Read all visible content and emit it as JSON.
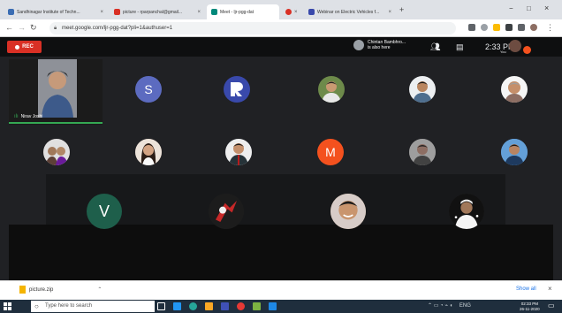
{
  "browser": {
    "tabs": [
      {
        "label": "Sandhinagar Institute of Techn...",
        "favicon_color": "#3b6db3"
      },
      {
        "label": "picture - rparpanchal@gmail...",
        "favicon_color": "#d93025"
      },
      {
        "label": "Meet - ljr-pgg-dat",
        "favicon_color": "#00897b",
        "active": true
      },
      {
        "label": "",
        "favicon_color": "#d93025"
      },
      {
        "label": "Webinar on Electric Vehicles f...",
        "favicon_color": "#3949ab"
      }
    ],
    "new_tab": "+",
    "window_controls": [
      "−",
      "□",
      "×"
    ],
    "url": "meet.google.com/ljr-pgg-dat?pli=1&authuser=1"
  },
  "meet": {
    "rec_label": "REC",
    "notice": {
      "name": "Chintan Bambhro...",
      "text": "is also here"
    },
    "time": "2:33 PM",
    "you_label": "You",
    "self_name": "Nirav Joshi",
    "participants": [
      {
        "kind": "letter",
        "letter": "S",
        "color": "#5c6bc0"
      },
      {
        "kind": "letter",
        "letter": "R",
        "color": "#3949ab"
      },
      {
        "kind": "photo",
        "color": "#6d8a4a"
      },
      {
        "kind": "photo",
        "color": "#8d6e63"
      },
      {
        "kind": "photo",
        "color": "#a1887f"
      },
      {
        "kind": "photo",
        "color": "#5d4037"
      },
      {
        "kind": "photo",
        "color": "#8d6e63"
      },
      {
        "kind": "photo",
        "color": "#5d6d7e"
      },
      {
        "kind": "letter",
        "letter": "M",
        "color": "#f4511e"
      },
      {
        "kind": "photo",
        "color": "#6d6d6d"
      },
      {
        "kind": "photo",
        "color": "#5b8fc7"
      },
      {
        "kind": "letter",
        "letter": "V",
        "color": "#1e5f4b"
      },
      {
        "kind": "photo",
        "color": "#b71c1c"
      },
      {
        "kind": "photo",
        "color": "#c8a27a"
      },
      {
        "kind": "photo",
        "color": "#333333"
      }
    ]
  },
  "downloads": {
    "file": "picture.zip",
    "show_all": "Show all"
  },
  "taskbar": {
    "search_placeholder": "Type here to search",
    "tray_lang": "ENG",
    "clock_time": "02:33 PM",
    "clock_date": "26-11-2020"
  }
}
